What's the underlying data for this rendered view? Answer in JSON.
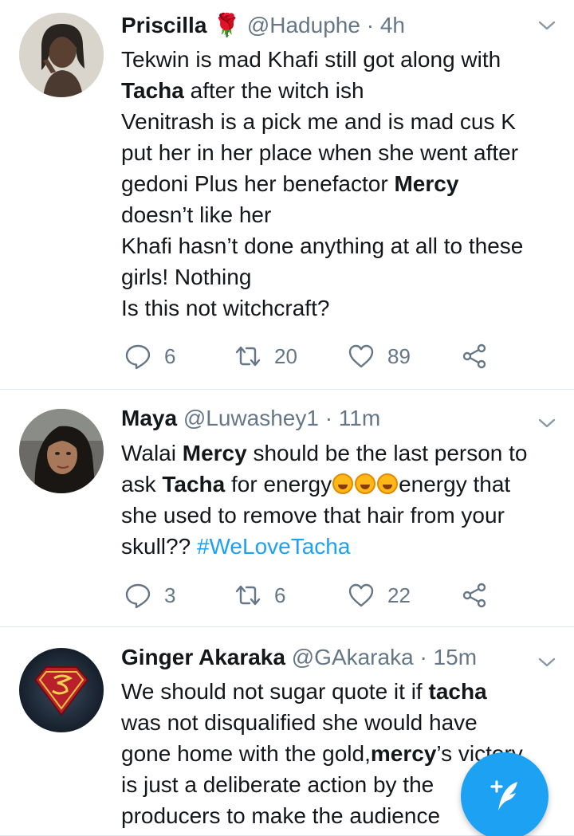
{
  "tweets": [
    {
      "name": "Priscilla",
      "name_extra": "🌹",
      "handle": "@Haduphe",
      "separator": "·",
      "time": "4h",
      "lines": [
        [
          {
            "t": "Tekwin is mad Khafi still got along with"
          }
        ],
        [
          {
            "t": "Tacha",
            "b": true
          },
          {
            "t": " after the witch ish"
          }
        ],
        [
          {
            "t": "Venitrash is a pick me and is mad cus K"
          }
        ],
        [
          {
            "t": "put her in her place when she went after"
          }
        ],
        [
          {
            "t": "gedoni Plus her benefactor "
          },
          {
            "t": "Mercy",
            "b": true
          }
        ],
        [
          {
            "t": "doesn’t like her"
          }
        ],
        [
          {
            "t": "Khafi hasn’t done anything at all to these"
          }
        ],
        [
          {
            "t": "girls! Nothing"
          }
        ],
        [
          {
            "t": "Is this not witchcraft?"
          }
        ]
      ],
      "replies": "6",
      "retweets": "20",
      "likes": "89"
    },
    {
      "name": "Maya",
      "name_extra": "",
      "handle": "@Luwashey1",
      "separator": "·",
      "time": "11m",
      "lines": [
        [
          {
            "t": "Walai "
          },
          {
            "t": "Mercy",
            "b": true
          },
          {
            "t": " should be the last person to"
          }
        ],
        [
          {
            "t": "ask "
          },
          {
            "t": "Tacha",
            "b": true
          },
          {
            "t": " for energy"
          },
          {
            "e": "rofl-emoji"
          },
          {
            "e": "rofl-emoji"
          },
          {
            "e": "rofl-emoji"
          },
          {
            "t": "energy that"
          }
        ],
        [
          {
            "t": "she used to remove that hair from your"
          }
        ],
        [
          {
            "t": "skull?? "
          },
          {
            "t": "#WeLoveTacha",
            "h": true
          }
        ]
      ],
      "replies": "3",
      "retweets": "6",
      "likes": "22"
    },
    {
      "name": "Ginger Akaraka",
      "name_extra": "",
      "handle": "@GAkaraka",
      "separator": "·",
      "time": "15m",
      "lines": [
        [
          {
            "t": "We should not sugar quote it if "
          },
          {
            "t": "tacha",
            "b": true
          }
        ],
        [
          {
            "t": "was not disqualified she would have"
          }
        ],
        [
          {
            "t": "gone home with the gold,"
          },
          {
            "t": "mercy",
            "b": true
          },
          {
            "t": "’s victory"
          }
        ],
        [
          {
            "t": "is just a deliberate action by the"
          }
        ],
        [
          {
            "t": "producers to make the audience"
          }
        ]
      ]
    }
  ],
  "icons": {
    "reply": "reply-icon",
    "retweet": "retweet-icon",
    "like": "heart-icon",
    "share": "share-icon",
    "menu": "chevron-down-icon",
    "compose": "compose-tweet-icon"
  },
  "colors": {
    "accent": "#1da1f2",
    "secondary_text": "#657786",
    "divider": "#e1e8ed"
  }
}
